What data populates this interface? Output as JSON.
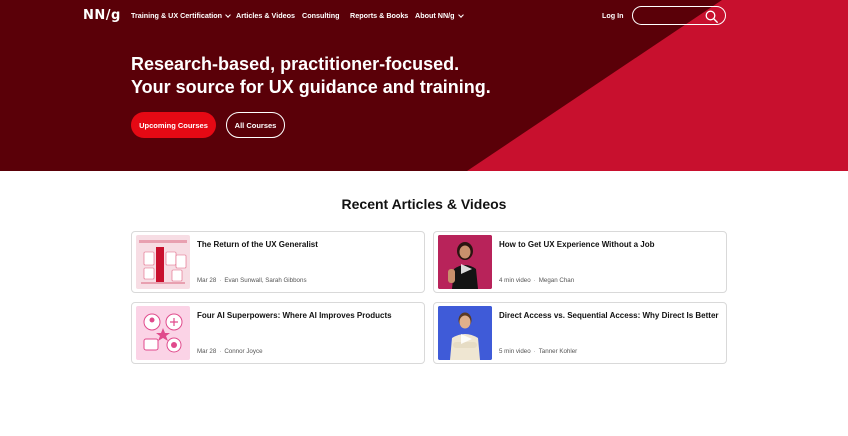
{
  "colors": {
    "hero_dark": "#5a0008",
    "hero_red": "#c8102e",
    "button_red": "#e50914"
  },
  "nav": {
    "logo": "NN/g",
    "items": [
      {
        "label": "Training & UX Certification",
        "has_dropdown": true
      },
      {
        "label": "Articles & Videos",
        "has_dropdown": false
      },
      {
        "label": "Consulting",
        "has_dropdown": false
      },
      {
        "label": "Reports & Books",
        "has_dropdown": false
      },
      {
        "label": "About NN/g",
        "has_dropdown": true
      }
    ],
    "login": "Log In",
    "search_icon": "search-icon"
  },
  "hero": {
    "line1": "Research-based, practitioner-focused.",
    "line2": "Your source for UX guidance and training.",
    "btn_upcoming": "Upcoming Courses",
    "btn_all": "All Courses"
  },
  "section": {
    "title": "Recent Articles & Videos"
  },
  "cards": [
    {
      "title": "The Return of the UX Generalist",
      "date": "Mar 28",
      "authors": "Evan Sunwall, Sarah Gibbons",
      "thumb": "illustration-pink",
      "video": false
    },
    {
      "title": "How to Get UX Experience Without a Job",
      "date": "4 min video",
      "authors": "Megan Chan",
      "thumb": "video-woman-dark",
      "video": true
    },
    {
      "title": "Four AI Superpowers: Where AI Improves Products",
      "date": "Mar 28",
      "authors": "Connor Joyce",
      "thumb": "illustration-ai",
      "video": false
    },
    {
      "title": "Direct Access vs. Sequential Access: Why Direct Is Better",
      "date": "5 min video",
      "authors": "Tanner Kohler",
      "thumb": "video-man-blue",
      "video": true
    }
  ]
}
